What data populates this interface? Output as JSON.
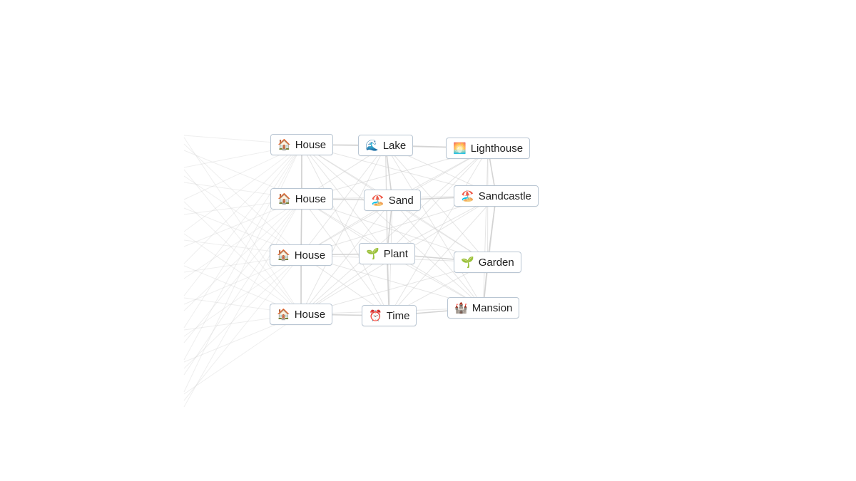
{
  "elements": [
    {
      "id": "house-1",
      "emoji": "🏠",
      "label": "House"
    },
    {
      "id": "lake",
      "emoji": "🌊",
      "label": "Lake"
    },
    {
      "id": "lighthouse",
      "emoji": "🌅",
      "label": "Lighthouse"
    },
    {
      "id": "house-2",
      "emoji": "🏠",
      "label": "House"
    },
    {
      "id": "sand",
      "emoji": "🏖️",
      "label": "Sand"
    },
    {
      "id": "sandcastle",
      "emoji": "🏖️",
      "label": "Sandcastle"
    },
    {
      "id": "house-3",
      "emoji": "🏠",
      "label": "House"
    },
    {
      "id": "plant",
      "emoji": "🌱",
      "label": "Plant"
    },
    {
      "id": "garden",
      "emoji": "🌱",
      "label": "Garden"
    },
    {
      "id": "house-4",
      "emoji": "🏠",
      "label": "House"
    },
    {
      "id": "time",
      "emoji": "⏰",
      "label": "Time"
    },
    {
      "id": "mansion",
      "emoji": "🏰",
      "label": "Mansion"
    }
  ],
  "colors": {
    "line": "#d0d0d0",
    "border": "#b9c6d3"
  }
}
